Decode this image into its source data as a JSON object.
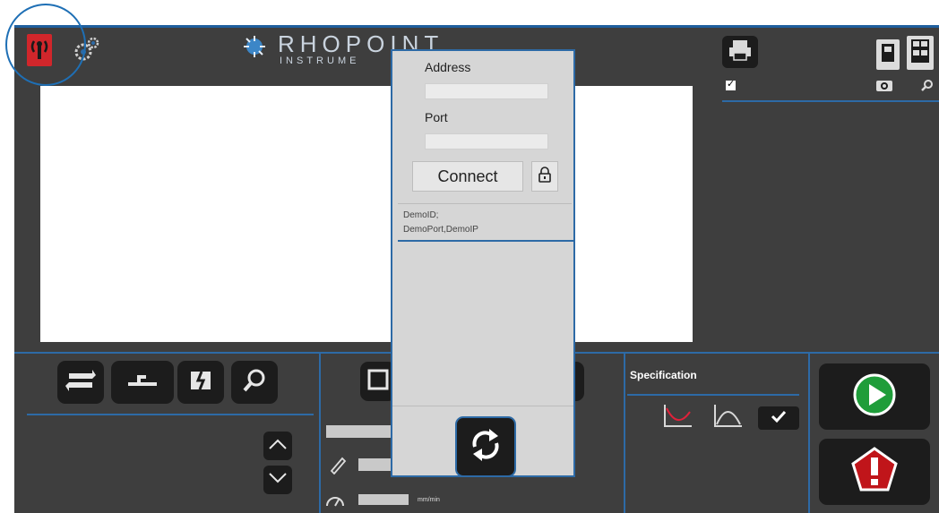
{
  "header": {
    "logo_main": "RHOPOINT",
    "logo_sub": "INSTRUME"
  },
  "connection_popup": {
    "address_label": "Address",
    "address_value": "",
    "port_label": "Port",
    "port_value": "",
    "connect_label": "Connect",
    "results": [
      "DemoID;",
      "DemoPort,DemoIP"
    ]
  },
  "specification_panel": {
    "title": "Specification"
  },
  "readouts": {
    "speed_unit": "mm/min"
  },
  "icons": {
    "top_left": [
      "antenna-icon",
      "settings-gears-icon"
    ],
    "top_right": [
      "printer-icon",
      "layout-single-icon",
      "layout-grid-icon",
      "camera-icon",
      "search-icon"
    ],
    "toolbar": [
      "swap-icon",
      "baseline-icon",
      "split-icon",
      "search-icon"
    ],
    "spec": [
      "min-curve-icon",
      "max-curve-icon",
      "check-icon"
    ],
    "actions": [
      "play-icon",
      "stop-alert-icon",
      "refresh-icon"
    ]
  },
  "colors": {
    "accent_blue": "#2d6aa6",
    "panel_background": "#3e3e3e",
    "play_green": "#1f9d3a",
    "stop_red": "#c0151a"
  }
}
